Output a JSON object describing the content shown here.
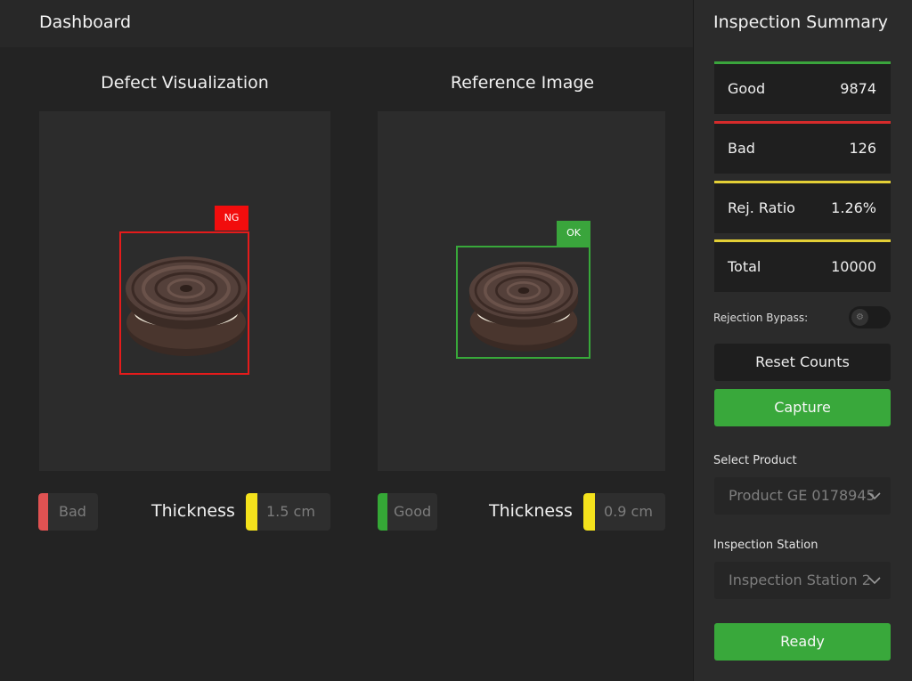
{
  "header": {
    "title": "Dashboard"
  },
  "left_panel": {
    "title": "Defect Visualization",
    "tag": "NG",
    "status": "Bad",
    "thickness_label": "Thickness",
    "thickness_value": "1.5 cm"
  },
  "right_panel": {
    "title": "Reference Image",
    "tag": "OK",
    "status": "Good",
    "thickness_label": "Thickness",
    "thickness_value": "0.9 cm"
  },
  "sidebar": {
    "title": "Inspection Summary",
    "stats": [
      {
        "label": "Good",
        "value": "9874",
        "color": "#3aa53c"
      },
      {
        "label": "Bad",
        "value": "126",
        "color": "#d62b2b"
      },
      {
        "label": "Rej. Ratio",
        "value": "1.26%",
        "color": "#e3cf36"
      },
      {
        "label": "Total",
        "value": "10000",
        "color": "#e3cf36"
      }
    ],
    "bypass_label": "Rejection Bypass:",
    "bypass_on": false,
    "reset_label": "Reset Counts",
    "capture_label": "Capture",
    "product_label": "Select Product",
    "product_value": "Product GE 0178945",
    "station_label": "Inspection Station",
    "station_value": "Inspection Station 2",
    "ready_label": "Ready"
  },
  "colors": {
    "ok_green": "#39a83b",
    "ng_red": "#f20d0d",
    "bad_bar": "#e05252",
    "good_bar": "#35a836",
    "thickness_bar": "#f4e21c"
  }
}
